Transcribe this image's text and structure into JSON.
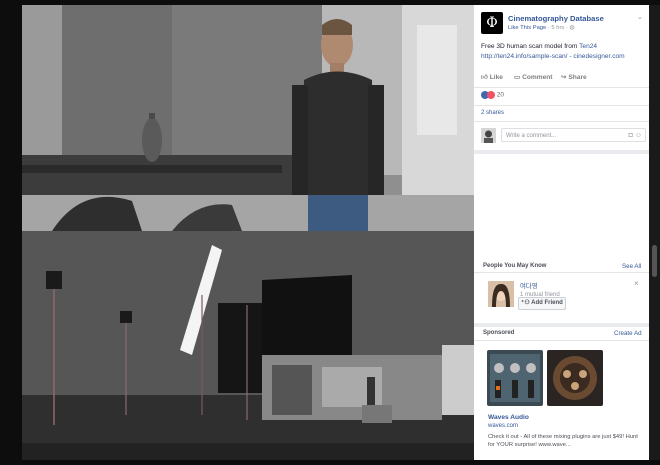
{
  "post": {
    "page_name": "Cinematography Database",
    "like_page": "Like This Page",
    "time": "· 5 hrs ·",
    "text_prefix": "Free 3D human scan model from ",
    "mention": "Ten24",
    "link_text": "http://ten24.info/sample-scan/ - cinedesigner.com",
    "actions": {
      "like": "Like",
      "comment": "Comment",
      "share": "Share"
    },
    "reaction_count": "20",
    "shares": "2 shares",
    "comment_placeholder": "Write a comment..."
  },
  "pymk": {
    "title": "People You May Know",
    "see_all": "See All",
    "person_name": "여다영",
    "mutual": "1 mutual friend",
    "add_friend": "Add Friend"
  },
  "sponsored": {
    "title": "Sponsored",
    "create_ad": "Create Ad",
    "ad_title": "Waves Audio",
    "ad_url": "waves.com",
    "ad_text": "Check it out - All of these mixing plugins are just $49! Hunt for YOUR surprise! www.wave..."
  },
  "colors": {
    "link_blue": "#365899",
    "like_blue": "#4267b2",
    "love_red": "#f25268"
  },
  "icons": {
    "logo": "phi-logo-icon",
    "chevron": "chevron-down-icon",
    "globe": "globe-icon",
    "like": "thumbs-up-icon",
    "comment": "comment-icon",
    "share": "share-icon",
    "camera": "camera-icon",
    "emoji": "smiley-icon",
    "add_friend": "add-friend-icon",
    "close": "close-icon"
  }
}
